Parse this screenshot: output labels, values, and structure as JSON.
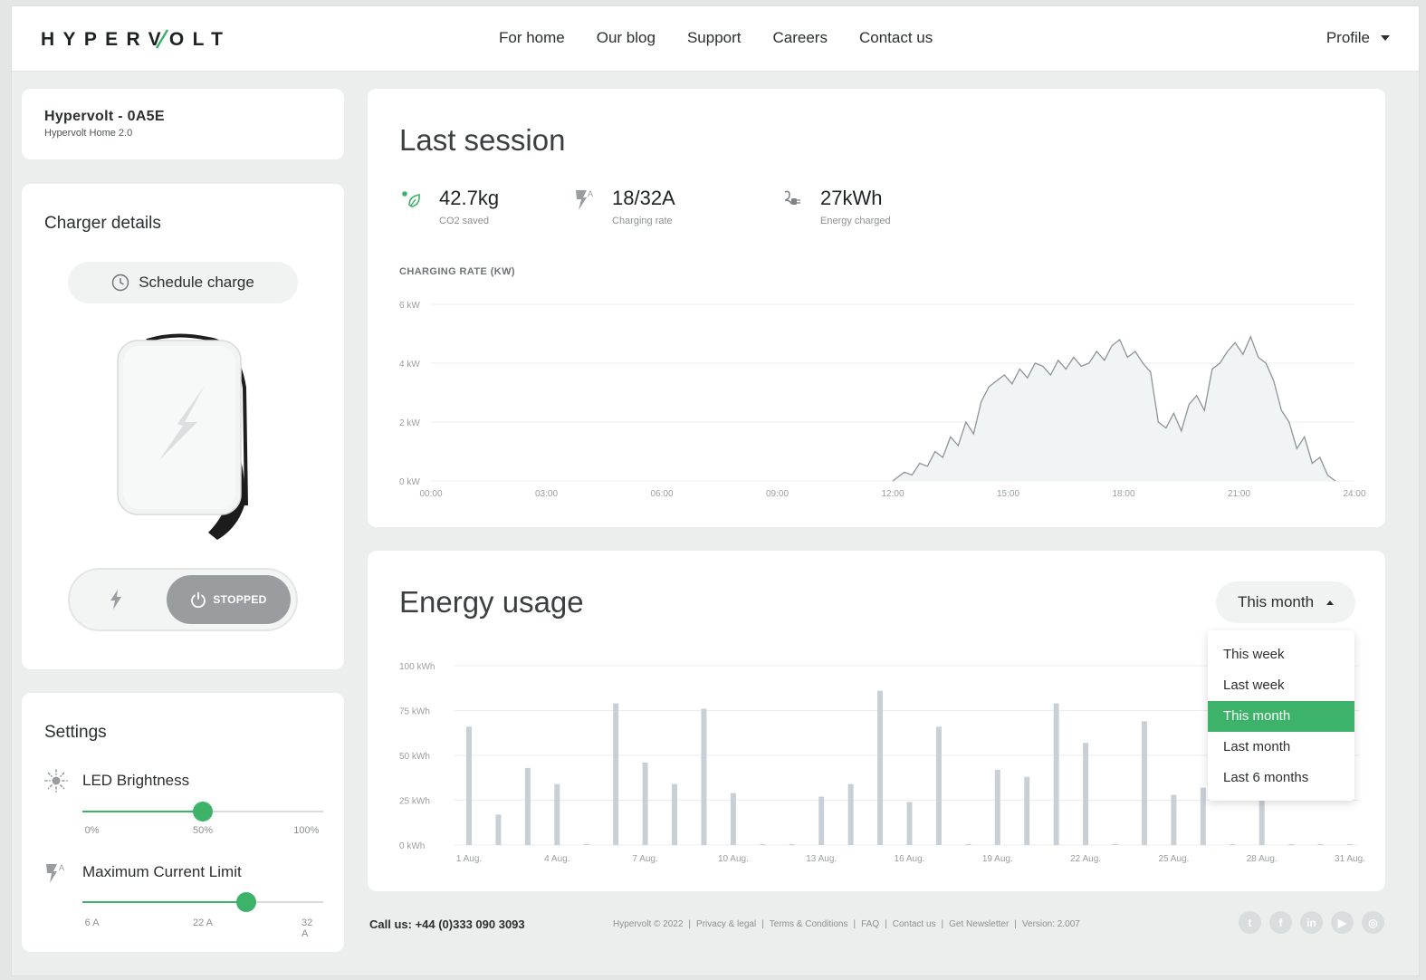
{
  "header": {
    "logo_text": "HYPERVOLT",
    "nav": [
      "For home",
      "Our blog",
      "Support",
      "Careers",
      "Contact us"
    ],
    "profile_label": "Profile"
  },
  "device": {
    "name": "Hypervolt - 0A5E",
    "model": "Hypervolt Home 2.0"
  },
  "charger": {
    "title": "Charger details",
    "schedule_label": "Schedule charge",
    "status_label": "STOPPED"
  },
  "settings": {
    "title": "Settings",
    "led": {
      "label": "LED Brightness",
      "value": 0.5,
      "ticks": [
        "0%",
        "50%",
        "100%"
      ]
    },
    "current": {
      "label": "Maximum Current Limit",
      "value": 0.68,
      "ticks": [
        "6 A",
        "22 A",
        "32 A"
      ]
    }
  },
  "session": {
    "title": "Last session",
    "stats": [
      {
        "value": "42.7kg",
        "label": "CO2 saved",
        "icon": "leaf-co2-icon"
      },
      {
        "value": "18/32A",
        "label": "Charging rate",
        "icon": "charging-rate-icon"
      },
      {
        "value": "27kWh",
        "label": "Energy charged",
        "icon": "plug-icon"
      }
    ],
    "chart_title": "CHARGING RATE (KW)"
  },
  "energy": {
    "title": "Energy usage",
    "range_label": "This month",
    "options": [
      "This week",
      "Last week",
      "This month",
      "Last month",
      "Last 6 months"
    ],
    "selected_option": 2
  },
  "footer": {
    "call": "Call us: +44 (0)333 090 3093",
    "links": [
      "Hypervolt © 2022",
      "Privacy & legal",
      "Terms & Conditions",
      "FAQ",
      "Contact us",
      "Get Newsletter",
      "Version: 2.007"
    ],
    "socials": [
      "twitter-icon",
      "facebook-icon",
      "linkedin-icon",
      "youtube-icon",
      "instagram-icon"
    ]
  },
  "colors": {
    "accent": "#3db36a",
    "line": "#8e9497",
    "bar": "#c8d0d6"
  },
  "chart_data": [
    {
      "type": "area",
      "title": "CHARGING RATE (KW)",
      "xlabel": "",
      "ylabel": "",
      "y_ticks": [
        "0 kW",
        "2 kW",
        "4 kW",
        "6 kW"
      ],
      "x_ticks": [
        "00:00",
        "03:00",
        "06:00",
        "09:00",
        "12:00",
        "15:00",
        "18:00",
        "21:00",
        "24:00"
      ],
      "ylim": [
        0,
        6
      ],
      "xlim": [
        0,
        24
      ],
      "x": [
        12.0,
        12.3,
        12.5,
        12.7,
        12.9,
        13.1,
        13.3,
        13.5,
        13.7,
        13.9,
        14.1,
        14.3,
        14.5,
        14.7,
        14.9,
        15.1,
        15.3,
        15.5,
        15.7,
        15.9,
        16.1,
        16.3,
        16.5,
        16.7,
        16.9,
        17.1,
        17.3,
        17.5,
        17.7,
        17.9,
        18.1,
        18.3,
        18.5,
        18.7,
        18.9,
        19.1,
        19.3,
        19.5,
        19.7,
        19.9,
        20.1,
        20.3,
        20.5,
        20.7,
        20.9,
        21.1,
        21.3,
        21.5,
        21.7,
        21.9,
        22.1,
        22.3,
        22.5,
        22.7,
        22.9,
        23.1,
        23.3,
        23.5
      ],
      "y": [
        0.0,
        0.3,
        0.2,
        0.6,
        0.5,
        1.0,
        0.8,
        1.5,
        1.2,
        2.0,
        1.6,
        2.7,
        3.2,
        3.4,
        3.6,
        3.3,
        3.8,
        3.5,
        4.0,
        3.9,
        3.6,
        4.1,
        3.8,
        4.2,
        3.9,
        4.0,
        4.4,
        4.1,
        4.6,
        4.8,
        4.2,
        4.4,
        4.0,
        3.7,
        2.0,
        1.8,
        2.3,
        1.7,
        2.6,
        2.9,
        2.4,
        3.8,
        4.0,
        4.4,
        4.7,
        4.3,
        4.9,
        4.2,
        4.0,
        3.4,
        2.4,
        2.0,
        1.1,
        1.5,
        0.6,
        0.8,
        0.2,
        0.0
      ]
    },
    {
      "type": "bar",
      "title": "",
      "xlabel": "",
      "ylabel": "",
      "y_ticks": [
        "0 kWh",
        "25 kWh",
        "50 kWh",
        "75 kWh",
        "100 kWh"
      ],
      "x_ticks": [
        "1 Aug.",
        "4 Aug.",
        "7 Aug.",
        "10 Aug.",
        "13 Aug.",
        "16 Aug.",
        "19 Aug.",
        "22 Aug.",
        "25 Aug.",
        "28 Aug.",
        "31 Aug."
      ],
      "ylim": [
        0,
        100
      ],
      "categories": [
        1,
        2,
        3,
        4,
        5,
        6,
        7,
        8,
        9,
        10,
        11,
        12,
        13,
        14,
        15,
        16,
        17,
        18,
        19,
        20,
        21,
        22,
        23,
        24,
        25,
        26,
        27,
        28,
        29,
        30,
        31
      ],
      "values": [
        66,
        17,
        43,
        34,
        0,
        79,
        46,
        34,
        76,
        29,
        0,
        0,
        27,
        34,
        86,
        24,
        66,
        0,
        42,
        38,
        79,
        57,
        0,
        69,
        28,
        32,
        0,
        25,
        0,
        0,
        0
      ]
    }
  ]
}
